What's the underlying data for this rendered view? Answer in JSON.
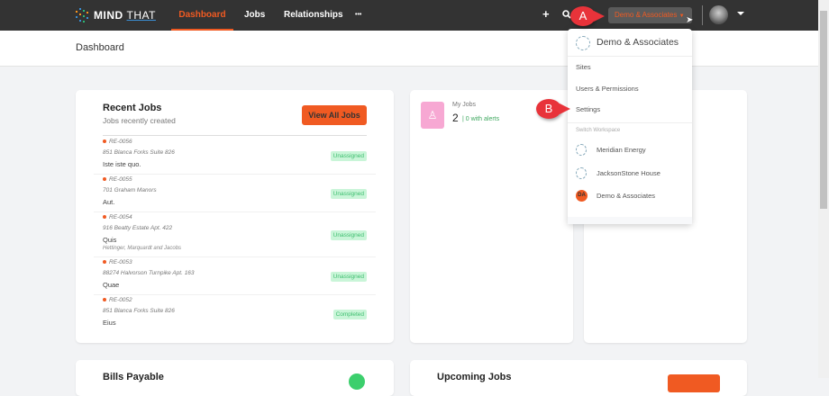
{
  "brand": {
    "name_bold": "MIND",
    "name_light": "THAT"
  },
  "nav": {
    "items": [
      "Dashboard",
      "Jobs",
      "Relationships",
      "•••"
    ],
    "add_icon": "+",
    "workspace": "Demo & Associates"
  },
  "page": {
    "title": "Dashboard"
  },
  "recent_jobs": {
    "title": "Recent Jobs",
    "subtitle": "Jobs recently created",
    "button": "View All Jobs",
    "rows": [
      {
        "id": "RE-0056",
        "address": "851 Blanca Forks Suite 826",
        "desc": "Iste iste quo.",
        "company": "",
        "status": "Unassigned"
      },
      {
        "id": "RE-0055",
        "address": "701 Graham Manors",
        "desc": "Aut.",
        "company": "",
        "status": "Unassigned"
      },
      {
        "id": "RE-0054",
        "address": "916 Beatty Estate Apt. 422",
        "desc": "Quis",
        "company": "Hettinger, Marquardt and Jacobs",
        "status": "Unassigned"
      },
      {
        "id": "RE-0053",
        "address": "88274 Halvorson Turnpike Apt. 163",
        "desc": "Quae",
        "company": "",
        "status": "Unassigned"
      },
      {
        "id": "RE-0052",
        "address": "851 Blanca Forks Suite 826",
        "desc": "Eius",
        "company": "",
        "status": "Completed"
      }
    ]
  },
  "my_jobs": {
    "label": "My Jobs",
    "count": "2",
    "alerts": "| 0 with alerts"
  },
  "bills": {
    "title": "Bills Payable"
  },
  "upcoming": {
    "title": "Upcoming Jobs"
  },
  "dropdown": {
    "title": "Demo & Associates",
    "items": [
      "Sites",
      "Users & Permissions",
      "Settings"
    ],
    "switch_label": "Switch Workspace",
    "workspaces": [
      {
        "name": "Meridian Energy"
      },
      {
        "name": "JacksonStone House"
      },
      {
        "name": "Demo & Associates",
        "initials": "DA"
      }
    ]
  },
  "callouts": {
    "a": "A",
    "b": "B"
  }
}
